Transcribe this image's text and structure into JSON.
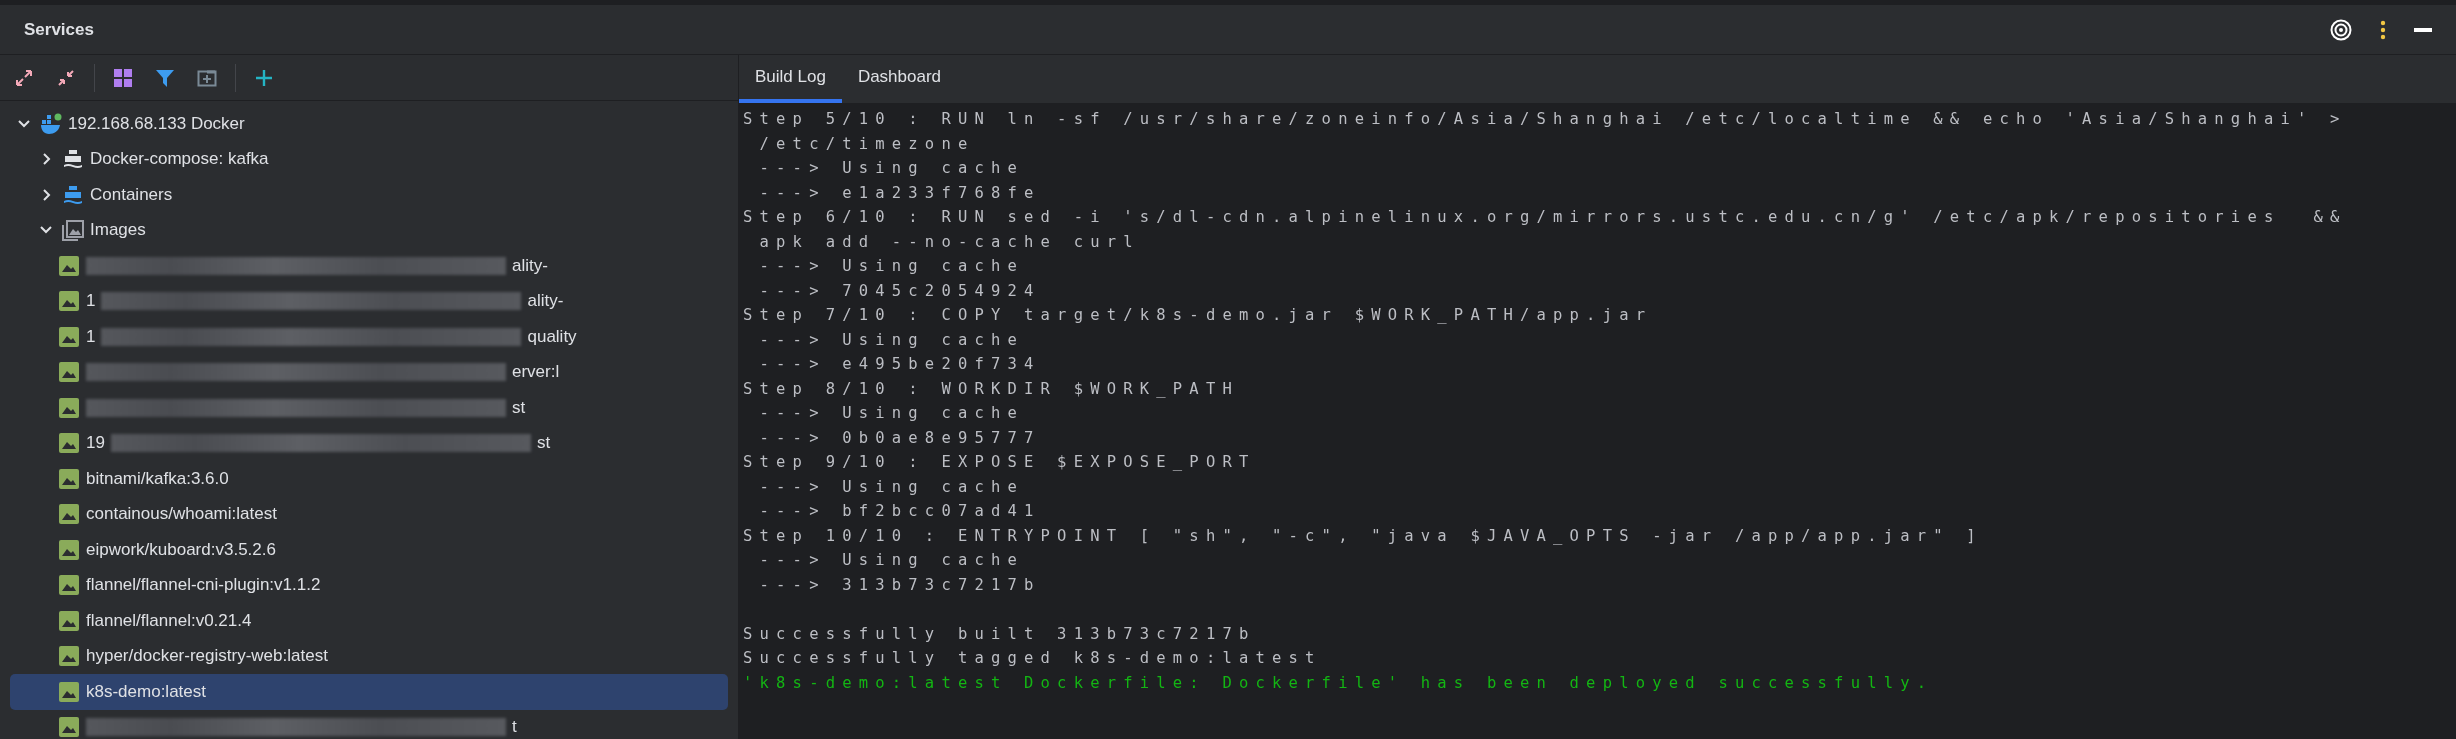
{
  "panel": {
    "title": "Services"
  },
  "toolbar": [
    {
      "kind": "expand"
    },
    {
      "kind": "collapse"
    },
    {
      "kind": "sep"
    },
    {
      "kind": "group"
    },
    {
      "kind": "filter"
    },
    {
      "kind": "new-tab"
    },
    {
      "kind": "sep"
    },
    {
      "kind": "add"
    }
  ],
  "tree": [
    {
      "kind": "host",
      "label": "192.168.68.133 Docker",
      "expanded": true,
      "selected": false,
      "children": [
        {
          "kind": "compose",
          "label": "Docker-compose: kafka",
          "expanded": false,
          "selected": false
        },
        {
          "kind": "containers",
          "label": "Containers",
          "expanded": false,
          "selected": false
        },
        {
          "kind": "images",
          "label": "Images",
          "expanded": true,
          "selected": false,
          "children": [
            {
              "kind": "redacted",
              "tail": "ality-",
              "selected": false
            },
            {
              "kind": "redacted",
              "lead": "1",
              "tail": "ality-",
              "selected": false
            },
            {
              "kind": "redacted",
              "lead": "1",
              "tail": "quality",
              "selected": false
            },
            {
              "kind": "redacted",
              "tail": "erver:l",
              "selected": false
            },
            {
              "kind": "redacted",
              "tail": "st",
              "selected": false
            },
            {
              "kind": "redacted",
              "lead": "19",
              "tail": "st",
              "selected": false
            },
            {
              "kind": "image",
              "label": "bitnami/kafka:3.6.0",
              "selected": false
            },
            {
              "kind": "image",
              "label": "containous/whoami:latest",
              "selected": false
            },
            {
              "kind": "image",
              "label": "eipwork/kuboard:v3.5.2.6",
              "selected": false
            },
            {
              "kind": "image",
              "label": "flannel/flannel-cni-plugin:v1.1.2",
              "selected": false
            },
            {
              "kind": "image",
              "label": "flannel/flannel:v0.21.4",
              "selected": false
            },
            {
              "kind": "image",
              "label": "hyper/docker-registry-web:latest",
              "selected": false
            },
            {
              "kind": "image",
              "label": "k8s-demo:latest",
              "selected": true
            },
            {
              "kind": "redacted",
              "tail": "t",
              "selected": false
            }
          ]
        }
      ]
    }
  ],
  "tabs": [
    {
      "label": "Build Log",
      "selected": true
    },
    {
      "label": "Dashboard",
      "selected": false
    }
  ],
  "log": [
    {
      "kind": "normal",
      "text": "Step 5/10 : RUN ln -sf /usr/share/zoneinfo/Asia/Shanghai /etc/localtime && echo 'Asia/Shanghai' >"
    },
    {
      "kind": "normal",
      "text": " /etc/timezone"
    },
    {
      "kind": "normal",
      "text": " ---> Using cache"
    },
    {
      "kind": "normal",
      "text": " ---> e1a233f768fe"
    },
    {
      "kind": "normal",
      "text": "Step 6/10 : RUN sed -i 's/dl-cdn.alpinelinux.org/mirrors.ustc.edu.cn/g' /etc/apk/repositories  &&"
    },
    {
      "kind": "normal",
      "text": " apk add --no-cache curl"
    },
    {
      "kind": "normal",
      "text": " ---> Using cache"
    },
    {
      "kind": "normal",
      "text": " ---> 7045c2054924"
    },
    {
      "kind": "normal",
      "text": "Step 7/10 : COPY target/k8s-demo.jar $WORK_PATH/app.jar"
    },
    {
      "kind": "normal",
      "text": " ---> Using cache"
    },
    {
      "kind": "normal",
      "text": " ---> e495be20f734"
    },
    {
      "kind": "normal",
      "text": "Step 8/10 : WORKDIR $WORK_PATH"
    },
    {
      "kind": "normal",
      "text": " ---> Using cache"
    },
    {
      "kind": "normal",
      "text": " ---> 0b0ae8e95777"
    },
    {
      "kind": "normal",
      "text": "Step 9/10 : EXPOSE $EXPOSE_PORT"
    },
    {
      "kind": "normal",
      "text": " ---> Using cache"
    },
    {
      "kind": "normal",
      "text": " ---> bf2bcc07ad41"
    },
    {
      "kind": "normal",
      "text": "Step 10/10 : ENTRYPOINT [ \"sh\", \"-c\", \"java $JAVA_OPTS -jar /app/app.jar\" ]"
    },
    {
      "kind": "normal",
      "text": " ---> Using cache"
    },
    {
      "kind": "normal",
      "text": " ---> 313b73c7217b"
    },
    {
      "kind": "blank"
    },
    {
      "kind": "normal",
      "text": "Successfully built 313b73c7217b"
    },
    {
      "kind": "normal",
      "text": "Successfully tagged k8s-demo:latest"
    },
    {
      "kind": "success",
      "text": "'k8s-demo:latest Dockerfile: Dockerfile' has been deployed successfully."
    }
  ]
}
